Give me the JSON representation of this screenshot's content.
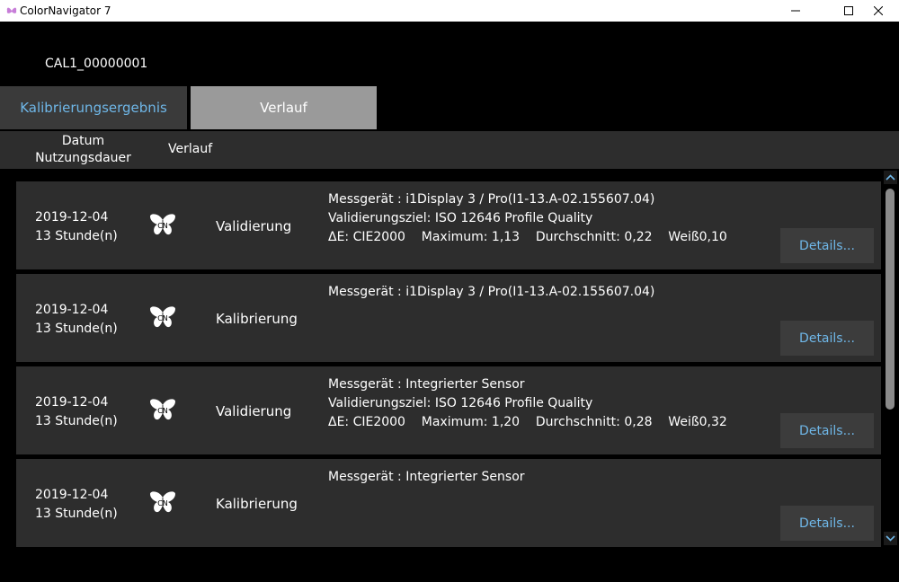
{
  "window": {
    "title": "ColorNavigator 7",
    "icon": "colornavigator-app-icon",
    "controls": [
      "minimize-icon",
      "maximize-icon",
      "close-icon"
    ]
  },
  "device": {
    "name": "CAL1_00000001"
  },
  "tabs": [
    {
      "label": "Kalibrierungsergebnis",
      "active": false
    },
    {
      "label": "Verlauf",
      "active": true
    }
  ],
  "columns": {
    "date_line1": "Datum",
    "date_line2": "Nutzungsdauer",
    "history": "Verlauf"
  },
  "rows": [
    {
      "date": "2019-12-04",
      "usage": "13 Stunde(n)",
      "icon": "cn-butterfly-icon",
      "type": "Validierung",
      "lines": [
        "Messgerät : i1Display 3 / Pro(I1-13.A-02.155607.04)",
        "Validierungsziel: ISO 12646 Profile Quality",
        "ΔE: CIE2000    Maximum: 1,13    Durchschnitt: 0,22    Weiß0,10"
      ],
      "button": "Details..."
    },
    {
      "date": "2019-12-04",
      "usage": "13 Stunde(n)",
      "icon": "cn-butterfly-icon",
      "type": "Kalibrierung",
      "lines": [
        "Messgerät : i1Display 3 / Pro(I1-13.A-02.155607.04)"
      ],
      "button": "Details..."
    },
    {
      "date": "2019-12-04",
      "usage": "13 Stunde(n)",
      "icon": "cn-butterfly-icon",
      "type": "Validierung",
      "lines": [
        "Messgerät : Integrierter Sensor",
        "Validierungsziel: ISO 12646 Profile Quality",
        "ΔE: CIE2000    Maximum: 1,20    Durchschnitt: 0,28    Weiß0,32"
      ],
      "button": "Details..."
    },
    {
      "date": "2019-12-04",
      "usage": "13 Stunde(n)",
      "icon": "cn-butterfly-icon",
      "type": "Kalibrierung",
      "lines": [
        "Messgerät : Integrierter Sensor"
      ],
      "button": "Details..."
    }
  ],
  "colors": {
    "background": "#000000",
    "row": "#2d2d2d",
    "accent": "#6fb7e8",
    "active_tab": "#9a9a9a"
  }
}
